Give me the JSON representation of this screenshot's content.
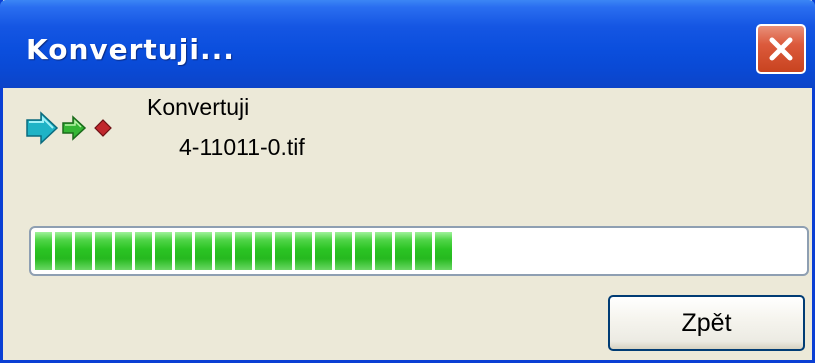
{
  "window": {
    "title": "Konvertuji..."
  },
  "message": {
    "line1": "Konvertuji",
    "line2": "4-11011-0.tif"
  },
  "progress": {
    "fraction": 0.52,
    "segments_filled": 21
  },
  "buttons": {
    "back_label": "Zpět"
  },
  "colors": {
    "titlebar": "#0b4fde",
    "window_bg": "#ece9d8",
    "progress_green": "#2bc424",
    "close_red": "#dc5a3c"
  },
  "icons": {
    "status": "convert-arrows-icon",
    "close": "close-icon"
  }
}
